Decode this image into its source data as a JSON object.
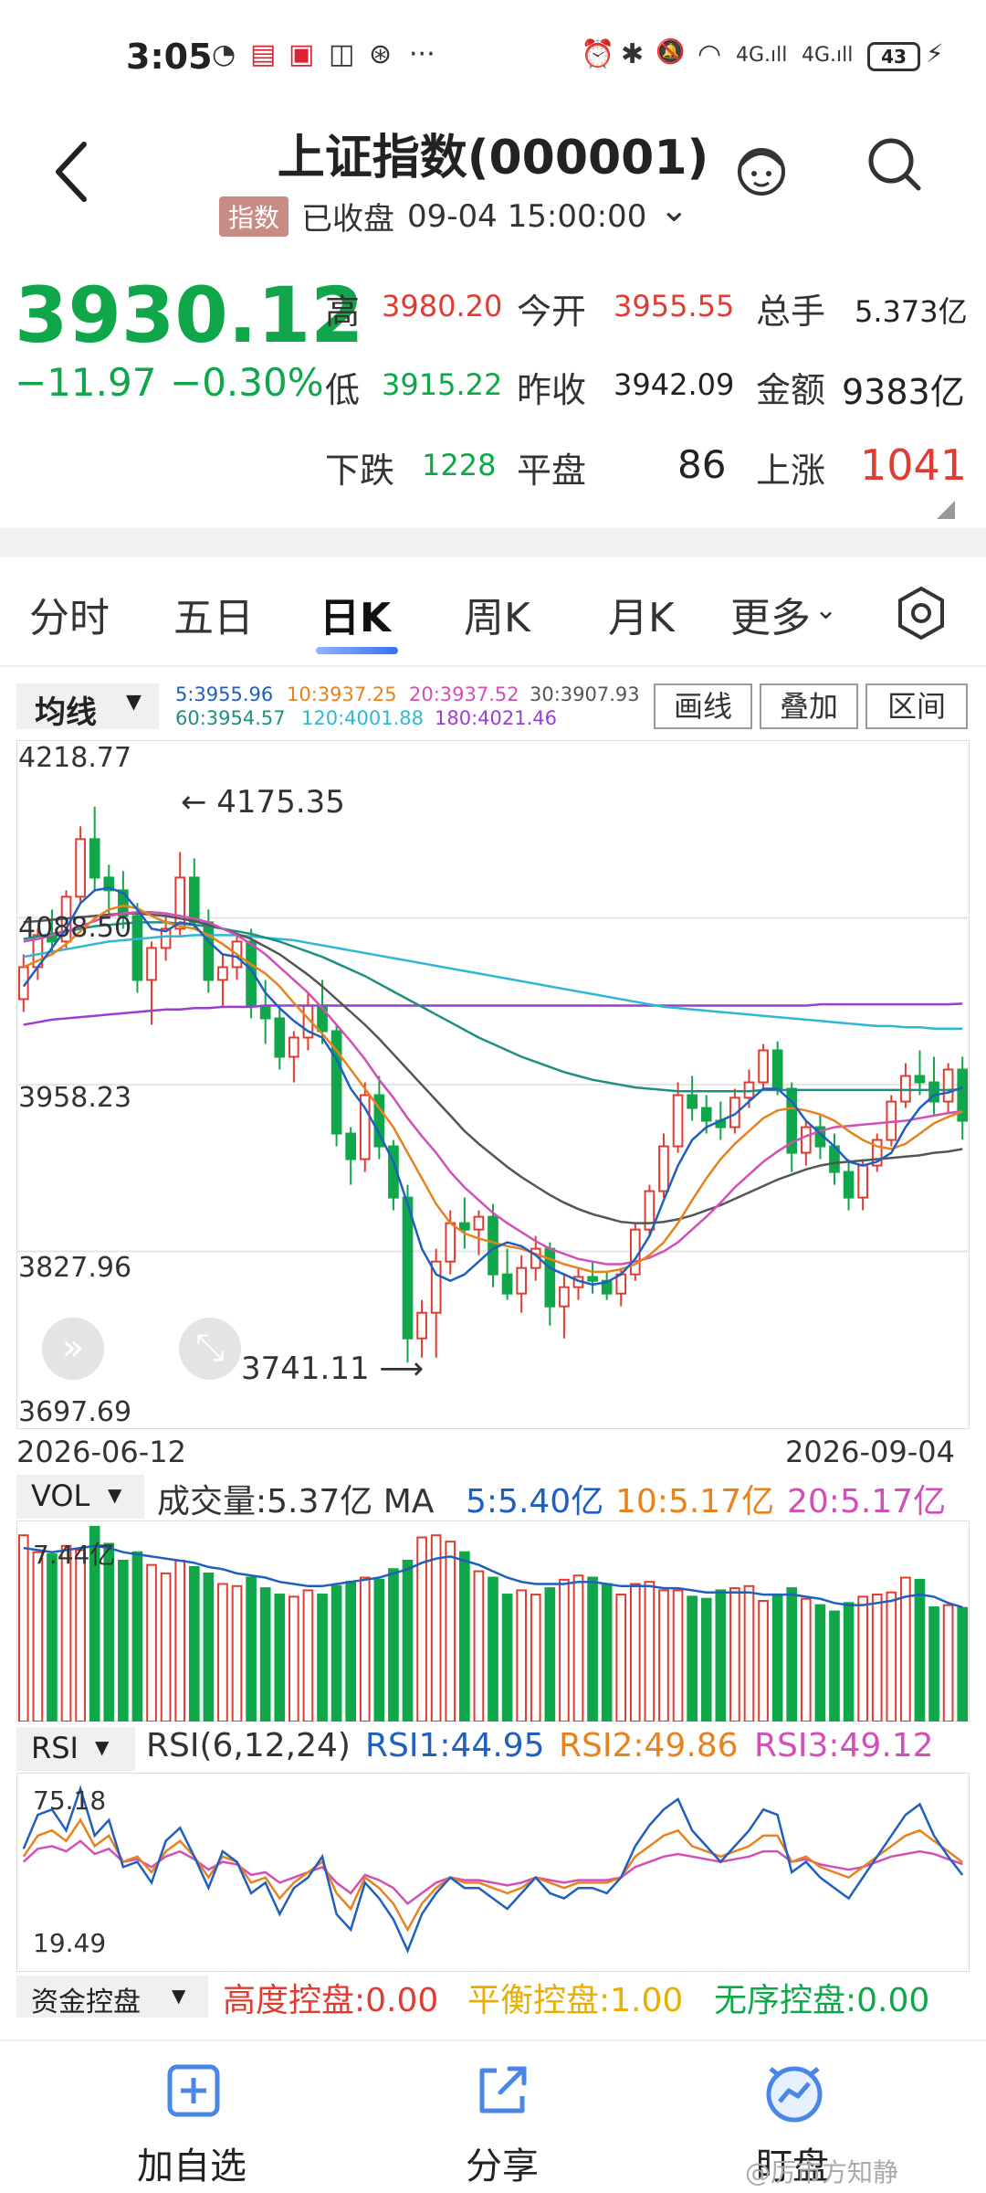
{
  "status_bar": {
    "time": "3:05",
    "glyphs": [
      "◔",
      "▤",
      "▣",
      "◫",
      "⊛",
      "···"
    ],
    "right_glyphs": [
      "⏰",
      "✱",
      "🔕",
      "◠",
      "4G.ıll",
      "4G.ıll"
    ],
    "battery": "43",
    "charging_icon": "⚡"
  },
  "header": {
    "title": "上证指数(000001)",
    "tag": "指数",
    "status": "已收盘",
    "datetime": "09-04 15:00:00",
    "chevron": "⌄"
  },
  "quote": {
    "price": "3930.12",
    "change": "−11.97",
    "change_pct": "−0.30%",
    "high_label": "高",
    "high": "3980.20",
    "open_label": "今开",
    "open": "3955.55",
    "vol_label": "总手",
    "vol": "5.373亿",
    "low_label": "低",
    "low": "3915.22",
    "prev_label": "昨收",
    "prev": "3942.09",
    "amt_label": "金额",
    "amt": "9383亿",
    "down_label": "下跌",
    "down": "1228",
    "flat_label": "平盘",
    "flat": "86",
    "up_label": "上涨",
    "up": "1041"
  },
  "tabs": [
    "分时",
    "五日",
    "日K",
    "周K",
    "月K",
    "更多"
  ],
  "ma_bar": {
    "dropdown": "均线",
    "ma5": "5:3955.96",
    "ma10": "10:3937.25",
    "ma20": "20:3937.52",
    "ma30": "30:3907.93",
    "ma60": "60:3954.57",
    "ma120": "120:4001.88",
    "ma180": "180:4021.46",
    "btn_draw": "画线",
    "btn_overlay": "叠加",
    "btn_range": "区间"
  },
  "colors": {
    "up": "#e03c31",
    "down": "#10a64a",
    "ma5": "#1f5fbf",
    "ma10": "#e8821e",
    "ma20": "#d24fb8",
    "ma30": "#555555",
    "ma60": "#1e9080",
    "ma120": "#2fb7d6",
    "ma180": "#9b3fd0"
  },
  "chart_data": [
    {
      "type": "candlestick",
      "title": "日K",
      "ylim": [
        3697.69,
        4218.77
      ],
      "y_ticks": [
        "4218.77",
        "4088.50",
        "3958.23",
        "3827.96",
        "3697.69"
      ],
      "x_range": [
        "2026-06-12",
        "2026-09-04"
      ],
      "annotations": {
        "high_mark": "4175.35",
        "low_mark": "3741.11"
      },
      "ohlc": [
        [
          4025,
          4060,
          4015,
          4050
        ],
        [
          4050,
          4080,
          4040,
          4075
        ],
        [
          4075,
          4095,
          4060,
          4070
        ],
        [
          4070,
          4110,
          4065,
          4105
        ],
        [
          4105,
          4160,
          4100,
          4150
        ],
        [
          4150,
          4175.35,
          4110,
          4120
        ],
        [
          4120,
          4130,
          4090,
          4110
        ],
        [
          4110,
          4125,
          4080,
          4090
        ],
        [
          4090,
          4100,
          4030,
          4040
        ],
        [
          4040,
          4070,
          4005,
          4065
        ],
        [
          4065,
          4090,
          4055,
          4080
        ],
        [
          4080,
          4140,
          4075,
          4120
        ],
        [
          4120,
          4135,
          4080,
          4085
        ],
        [
          4085,
          4095,
          4030,
          4040
        ],
        [
          4040,
          4060,
          4020,
          4050
        ],
        [
          4050,
          4075,
          4040,
          4070
        ],
        [
          4070,
          4080,
          4010,
          4020
        ],
        [
          4020,
          4040,
          3990,
          4010
        ],
        [
          4010,
          4020,
          3970,
          3980
        ],
        [
          3980,
          4000,
          3960,
          3995
        ],
        [
          3995,
          4030,
          3985,
          4020
        ],
        [
          4020,
          4040,
          3990,
          4000
        ],
        [
          4000,
          4005,
          3910,
          3920
        ],
        [
          3920,
          3925,
          3880,
          3900
        ],
        [
          3900,
          3960,
          3890,
          3950
        ],
        [
          3950,
          3965,
          3900,
          3910
        ],
        [
          3910,
          3915,
          3860,
          3870
        ],
        [
          3870,
          3880,
          3741.11,
          3760
        ],
        [
          3760,
          3790,
          3745,
          3780
        ],
        [
          3780,
          3830,
          3745,
          3820
        ],
        [
          3820,
          3860,
          3810,
          3850
        ],
        [
          3850,
          3870,
          3830,
          3845
        ],
        [
          3845,
          3860,
          3825,
          3855
        ],
        [
          3855,
          3865,
          3800,
          3810
        ],
        [
          3810,
          3830,
          3790,
          3795
        ],
        [
          3795,
          3825,
          3780,
          3815
        ],
        [
          3815,
          3840,
          3805,
          3830
        ],
        [
          3830,
          3835,
          3770,
          3785
        ],
        [
          3785,
          3810,
          3760,
          3800
        ],
        [
          3800,
          3815,
          3790,
          3808
        ],
        [
          3808,
          3820,
          3795,
          3805
        ],
        [
          3805,
          3812,
          3790,
          3795
        ],
        [
          3795,
          3815,
          3785,
          3810
        ],
        [
          3810,
          3850,
          3805,
          3845
        ],
        [
          3845,
          3880,
          3840,
          3875
        ],
        [
          3875,
          3920,
          3870,
          3910
        ],
        [
          3910,
          3960,
          3905,
          3950
        ],
        [
          3950,
          3965,
          3930,
          3940
        ],
        [
          3940,
          3950,
          3920,
          3930
        ],
        [
          3930,
          3945,
          3915,
          3925
        ],
        [
          3925,
          3955,
          3920,
          3948
        ],
        [
          3948,
          3970,
          3940,
          3960
        ],
        [
          3960,
          3990,
          3955,
          3985
        ],
        [
          3985,
          3992,
          3950,
          3955
        ],
        [
          3955,
          3960,
          3890,
          3905
        ],
        [
          3905,
          3930,
          3895,
          3925
        ],
        [
          3925,
          3935,
          3900,
          3910
        ],
        [
          3910,
          3920,
          3880,
          3890
        ],
        [
          3890,
          3900,
          3860,
          3870
        ],
        [
          3870,
          3900,
          3860,
          3895
        ],
        [
          3895,
          3920,
          3890,
          3915
        ],
        [
          3915,
          3950,
          3910,
          3945
        ],
        [
          3945,
          3975,
          3940,
          3965
        ],
        [
          3965,
          3985,
          3950,
          3960
        ],
        [
          3960,
          3980,
          3935,
          3945
        ],
        [
          3945,
          3975,
          3935,
          3970
        ],
        [
          3970,
          3980,
          3915.22,
          3930
        ]
      ],
      "ma5": [
        4035,
        4050,
        4065,
        4080,
        4100,
        4110,
        4112,
        4108,
        4095,
        4080,
        4078,
        4085,
        4083,
        4070,
        4060,
        4058,
        4048,
        4030,
        4018,
        4008,
        4000,
        3995,
        3978,
        3955,
        3940,
        3920,
        3898,
        3865,
        3830,
        3810,
        3805,
        3810,
        3820,
        3830,
        3835,
        3832,
        3825,
        3815,
        3810,
        3805,
        3802,
        3804,
        3810,
        3822,
        3840,
        3868,
        3895,
        3915,
        3925,
        3930,
        3935,
        3945,
        3955,
        3955,
        3945,
        3930,
        3920,
        3910,
        3898,
        3895,
        3898,
        3905,
        3925,
        3940,
        3950,
        3952,
        3955.96
      ],
      "ma10": [
        4050,
        4055,
        4060,
        4068,
        4078,
        4088,
        4095,
        4098,
        4096,
        4090,
        4085,
        4082,
        4080,
        4075,
        4068,
        4060,
        4052,
        4045,
        4035,
        4022,
        4010,
        3998,
        3985,
        3970,
        3955,
        3940,
        3925,
        3905,
        3885,
        3865,
        3850,
        3842,
        3838,
        3835,
        3832,
        3830,
        3826,
        3822,
        3818,
        3815,
        3812,
        3812,
        3814,
        3818,
        3825,
        3835,
        3850,
        3868,
        3885,
        3900,
        3912,
        3922,
        3932,
        3938,
        3940,
        3938,
        3935,
        3930,
        3922,
        3915,
        3910,
        3908,
        3912,
        3920,
        3928,
        3933,
        3937.25
      ],
      "ma20": [
        4070,
        4072,
        4075,
        4078,
        4082,
        4086,
        4090,
        4092,
        4093,
        4093,
        4092,
        4090,
        4088,
        4085,
        4080,
        4075,
        4068,
        4060,
        4050,
        4040,
        4030,
        4018,
        4005,
        3992,
        3978,
        3962,
        3948,
        3932,
        3918,
        3905,
        3890,
        3878,
        3868,
        3858,
        3850,
        3843,
        3836,
        3830,
        3826,
        3822,
        3820,
        3818,
        3818,
        3820,
        3823,
        3828,
        3835,
        3845,
        3855,
        3866,
        3878,
        3888,
        3898,
        3906,
        3913,
        3918,
        3922,
        3925,
        3926,
        3927,
        3928,
        3929,
        3930,
        3932,
        3934,
        3936,
        3937.52
      ],
      "ma30": [
        4085,
        4086,
        4087,
        4088,
        4089,
        4090,
        4091,
        4092,
        4092,
        4091,
        4090,
        4088,
        4086,
        4083,
        4080,
        4076,
        4072,
        4066,
        4060,
        4052,
        4044,
        4035,
        4025,
        4015,
        4005,
        3994,
        3982,
        3970,
        3958,
        3946,
        3934,
        3922,
        3912,
        3903,
        3894,
        3886,
        3879,
        3872,
        3866,
        3861,
        3857,
        3854,
        3851,
        3850,
        3850,
        3851,
        3853,
        3856,
        3860,
        3864,
        3869,
        3874,
        3879,
        3884,
        3888,
        3892,
        3895,
        3897,
        3898,
        3899,
        3900,
        3901,
        3902,
        3903,
        3905,
        3906,
        3907.93
      ],
      "ma60": [
        4072,
        4074,
        4076,
        4078,
        4080,
        4082,
        4083,
        4084,
        4085,
        4085,
        4085,
        4084,
        4083,
        4082,
        4080,
        4078,
        4076,
        4073,
        4070,
        4066,
        4062,
        4058,
        4053,
        4048,
        4043,
        4037,
        4031,
        4025,
        4019,
        4013,
        4007,
        4001,
        3995,
        3990,
        3985,
        3980,
        3976,
        3972,
        3968,
        3965,
        3962,
        3960,
        3958,
        3956,
        3955,
        3954,
        3953,
        3953,
        3953,
        3953,
        3953,
        3953,
        3954,
        3954,
        3954,
        3954,
        3954,
        3954,
        3954,
        3954,
        3954,
        3954,
        3954,
        3954,
        3954,
        3954,
        3954.57
      ],
      "ma120": [
        4058,
        4060,
        4062,
        4064,
        4066,
        4068,
        4070,
        4071,
        4072,
        4073,
        4074,
        4074,
        4075,
        4075,
        4075,
        4075,
        4074,
        4073,
        4072,
        4071,
        4069,
        4067,
        4065,
        4063,
        4061,
        4059,
        4057,
        4055,
        4053,
        4051,
        4049,
        4047,
        4045,
        4043,
        4041,
        4039,
        4037,
        4035,
        4033,
        4031,
        4029,
        4027,
        4025,
        4023,
        4021,
        4019,
        4018,
        4017,
        4016,
        4015,
        4014,
        4013,
        4012,
        4011,
        4010,
        4009,
        4008,
        4007,
        4006,
        4005,
        4004,
        4004,
        4003,
        4003,
        4002,
        4002,
        4001.88
      ],
      "ma180": [
        4005,
        4007,
        4009,
        4010,
        4011,
        4012,
        4013,
        4014,
        4015,
        4016,
        4017,
        4017,
        4018,
        4018,
        4019,
        4019,
        4019,
        4020,
        4020,
        4020,
        4020,
        4020,
        4020,
        4020,
        4020,
        4020,
        4020,
        4020,
        4020,
        4020,
        4020,
        4020,
        4020,
        4020,
        4020,
        4020,
        4020,
        4020,
        4020,
        4020,
        4020,
        4020,
        4020,
        4020,
        4020,
        4020,
        4020,
        4020,
        4020,
        4020,
        4020,
        4020,
        4020,
        4020,
        4020,
        4020,
        4021,
        4021,
        4021,
        4021,
        4021,
        4021,
        4021,
        4021,
        4021,
        4021,
        4021.46
      ]
    },
    {
      "type": "bar",
      "title": "成交量",
      "label_dropdown": "VOL",
      "legend": "成交量:5.37亿 MA",
      "ma5": "5:5.40亿",
      "ma10": "10:5.17亿",
      "ma20": "20:5.17亿",
      "y_tick": "7.44亿",
      "ylim": [
        0,
        9.5
      ],
      "values": [
        8.8,
        8.0,
        7.9,
        8.3,
        8.1,
        9.2,
        8.4,
        7.6,
        8.0,
        7.4,
        7.0,
        7.6,
        7.3,
        7.0,
        6.5,
        6.4,
        6.8,
        6.3,
        6.0,
        5.9,
        6.2,
        6.0,
        6.4,
        6.6,
        6.8,
        6.7,
        7.2,
        7.6,
        8.7,
        8.8,
        8.5,
        8.0,
        7.1,
        6.8,
        6.0,
        6.2,
        6.0,
        6.3,
        6.7,
        6.9,
        6.8,
        6.5,
        6.0,
        6.5,
        6.6,
        6.2,
        6.2,
        5.9,
        5.8,
        6.2,
        6.3,
        6.4,
        5.7,
        6.0,
        6.3,
        5.8,
        5.5,
        5.2,
        5.6,
        5.9,
        6.0,
        6.1,
        6.8,
        6.7,
        5.4,
        5.5,
        5.37
      ],
      "ma_line": [
        8.2,
        8.1,
        8.0,
        8.1,
        8.2,
        8.3,
        8.2,
        8.0,
        7.9,
        7.8,
        7.7,
        7.6,
        7.5,
        7.3,
        7.2,
        7.0,
        6.9,
        6.8,
        6.6,
        6.5,
        6.4,
        6.4,
        6.5,
        6.6,
        6.7,
        6.8,
        7.0,
        7.2,
        7.5,
        7.7,
        7.8,
        7.6,
        7.4,
        7.1,
        6.8,
        6.6,
        6.5,
        6.5,
        6.5,
        6.6,
        6.6,
        6.5,
        6.4,
        6.4,
        6.4,
        6.3,
        6.3,
        6.2,
        6.1,
        6.1,
        6.1,
        6.1,
        6.0,
        6.0,
        6.0,
        5.9,
        5.8,
        5.6,
        5.5,
        5.5,
        5.6,
        5.7,
        5.9,
        6.0,
        5.9,
        5.6,
        5.4
      ]
    },
    {
      "type": "line",
      "title": "RSI",
      "label_dropdown": "RSI",
      "params": "RSI(6,12,24)",
      "rsi1_label": "RSI1:44.95",
      "rsi2_label": "RSI2:49.86",
      "rsi3_label": "RSI3:49.12",
      "y_ticks": [
        "75.18",
        "19.49"
      ],
      "ylim": [
        10,
        82
      ],
      "rsi1": [
        55,
        68,
        70,
        62,
        78,
        60,
        66,
        48,
        50,
        42,
        58,
        63,
        52,
        40,
        54,
        50,
        38,
        42,
        30,
        40,
        44,
        52,
        30,
        24,
        42,
        36,
        28,
        16,
        30,
        38,
        44,
        40,
        40,
        36,
        32,
        38,
        44,
        38,
        36,
        40,
        40,
        38,
        44,
        56,
        64,
        70,
        74,
        62,
        56,
        50,
        56,
        62,
        70,
        68,
        46,
        50,
        44,
        40,
        36,
        44,
        52,
        60,
        68,
        72,
        60,
        52,
        44.95
      ],
      "rsi2": [
        52,
        60,
        62,
        58,
        66,
        56,
        60,
        50,
        52,
        46,
        54,
        58,
        52,
        44,
        52,
        50,
        42,
        44,
        36,
        42,
        46,
        50,
        38,
        32,
        44,
        40,
        34,
        24,
        34,
        40,
        44,
        42,
        42,
        40,
        38,
        40,
        44,
        42,
        40,
        42,
        42,
        42,
        44,
        52,
        56,
        60,
        62,
        56,
        54,
        52,
        54,
        56,
        60,
        60,
        50,
        52,
        48,
        46,
        44,
        48,
        52,
        56,
        60,
        62,
        58,
        54,
        49.86
      ],
      "rsi3": [
        50,
        55,
        56,
        54,
        58,
        53,
        55,
        50,
        51,
        48,
        52,
        54,
        51,
        47,
        50,
        49,
        45,
        46,
        42,
        44,
        46,
        48,
        42,
        38,
        45,
        43,
        40,
        34,
        38,
        42,
        44,
        43,
        43,
        42,
        41,
        42,
        44,
        43,
        42,
        43,
        43,
        43,
        44,
        48,
        50,
        52,
        53,
        52,
        51,
        50,
        51,
        52,
        54,
        54,
        50,
        51,
        49,
        48,
        47,
        48,
        50,
        52,
        53,
        54,
        53,
        51,
        49.12
      ]
    }
  ],
  "capital": {
    "dropdown": "资金控盘",
    "high": "高度控盘:0.00",
    "balance": "平衡控盘:1.00",
    "disorder": "无序控盘:0.00"
  },
  "bottom_nav": [
    "加自选",
    "分享",
    "盯盘"
  ],
  "watermark": "@厉市方知静"
}
